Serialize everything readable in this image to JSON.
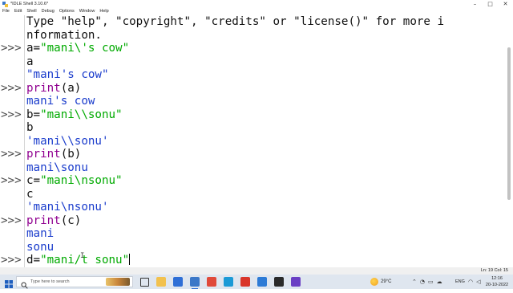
{
  "window": {
    "title": "*IDLE Shell 3.10.6*",
    "controls": {
      "minimize": "–",
      "maximize": "□",
      "close": "✕"
    }
  },
  "menu": [
    "File",
    "Edit",
    "Shell",
    "Debug",
    "Options",
    "Window",
    "Help"
  ],
  "shell": {
    "prompt": ">>>",
    "lines": [
      {
        "prompt": false,
        "text": "Type \"help\", \"copyright\", \"credits\" or \"license()\" for more i",
        "kind": "def"
      },
      {
        "prompt": false,
        "text": "nformation.",
        "kind": "def"
      },
      {
        "prompt": true,
        "code": "a=",
        "str": "\"mani\\'s cow\"",
        "kind": "input"
      },
      {
        "prompt": false,
        "text": "a",
        "kind": "def"
      },
      {
        "prompt": false,
        "text": "\"mani's cow\"",
        "kind": "out"
      },
      {
        "prompt": true,
        "builtin": "print",
        "code": "(a)",
        "kind": "input"
      },
      {
        "prompt": false,
        "text": "mani's cow",
        "kind": "out"
      },
      {
        "prompt": true,
        "code": "b=",
        "str": "\"mani\\\\sonu\"",
        "kind": "input"
      },
      {
        "prompt": false,
        "text": "b",
        "kind": "def"
      },
      {
        "prompt": false,
        "text": "'mani\\\\sonu'",
        "kind": "out"
      },
      {
        "prompt": true,
        "builtin": "print",
        "code": "(b)",
        "kind": "input"
      },
      {
        "prompt": false,
        "text": "mani\\sonu",
        "kind": "out"
      },
      {
        "prompt": true,
        "code": "c=",
        "str": "\"mani\\nsonu\"",
        "kind": "input"
      },
      {
        "prompt": false,
        "text": "c",
        "kind": "def"
      },
      {
        "prompt": false,
        "text": "'mani\\nsonu'",
        "kind": "out"
      },
      {
        "prompt": true,
        "builtin": "print",
        "code": "(c)",
        "kind": "input"
      },
      {
        "prompt": false,
        "text": "mani",
        "kind": "out"
      },
      {
        "prompt": false,
        "text": "sonu",
        "kind": "out"
      },
      {
        "prompt": true,
        "code": "d=",
        "str": "\"mani/t sonu\"",
        "kind": "input",
        "cursor": true
      }
    ]
  },
  "status": {
    "position": "Ln: 19  Col: 15"
  },
  "taskbar": {
    "search_placeholder": "Type here to search",
    "weather": "29°C",
    "language": "ENG",
    "time": "12:16",
    "date": "20-10-2022",
    "apps": [
      {
        "icon": "task-view-icon",
        "color": "#ffffff"
      },
      {
        "icon": "file-explorer-icon",
        "color": "#f2c14e"
      },
      {
        "icon": "store-icon",
        "color": "#2f6fd6"
      },
      {
        "icon": "idle-python-icon",
        "color": "#3c78c8"
      },
      {
        "icon": "chrome-icon",
        "color": "#e04a3a"
      },
      {
        "icon": "edge-icon",
        "color": "#1b9ad6"
      },
      {
        "icon": "wps-icon",
        "color": "#d9362b"
      },
      {
        "icon": "mail-icon",
        "color": "#2d7bd6"
      },
      {
        "icon": "media-icon",
        "color": "#2a2a2a"
      },
      {
        "icon": "app-icon",
        "color": "#6a3fc4"
      }
    ]
  },
  "colors": {
    "string": "#00aa00",
    "output": "#1a3ccc",
    "builtin": "#900090",
    "default": "#111111"
  }
}
